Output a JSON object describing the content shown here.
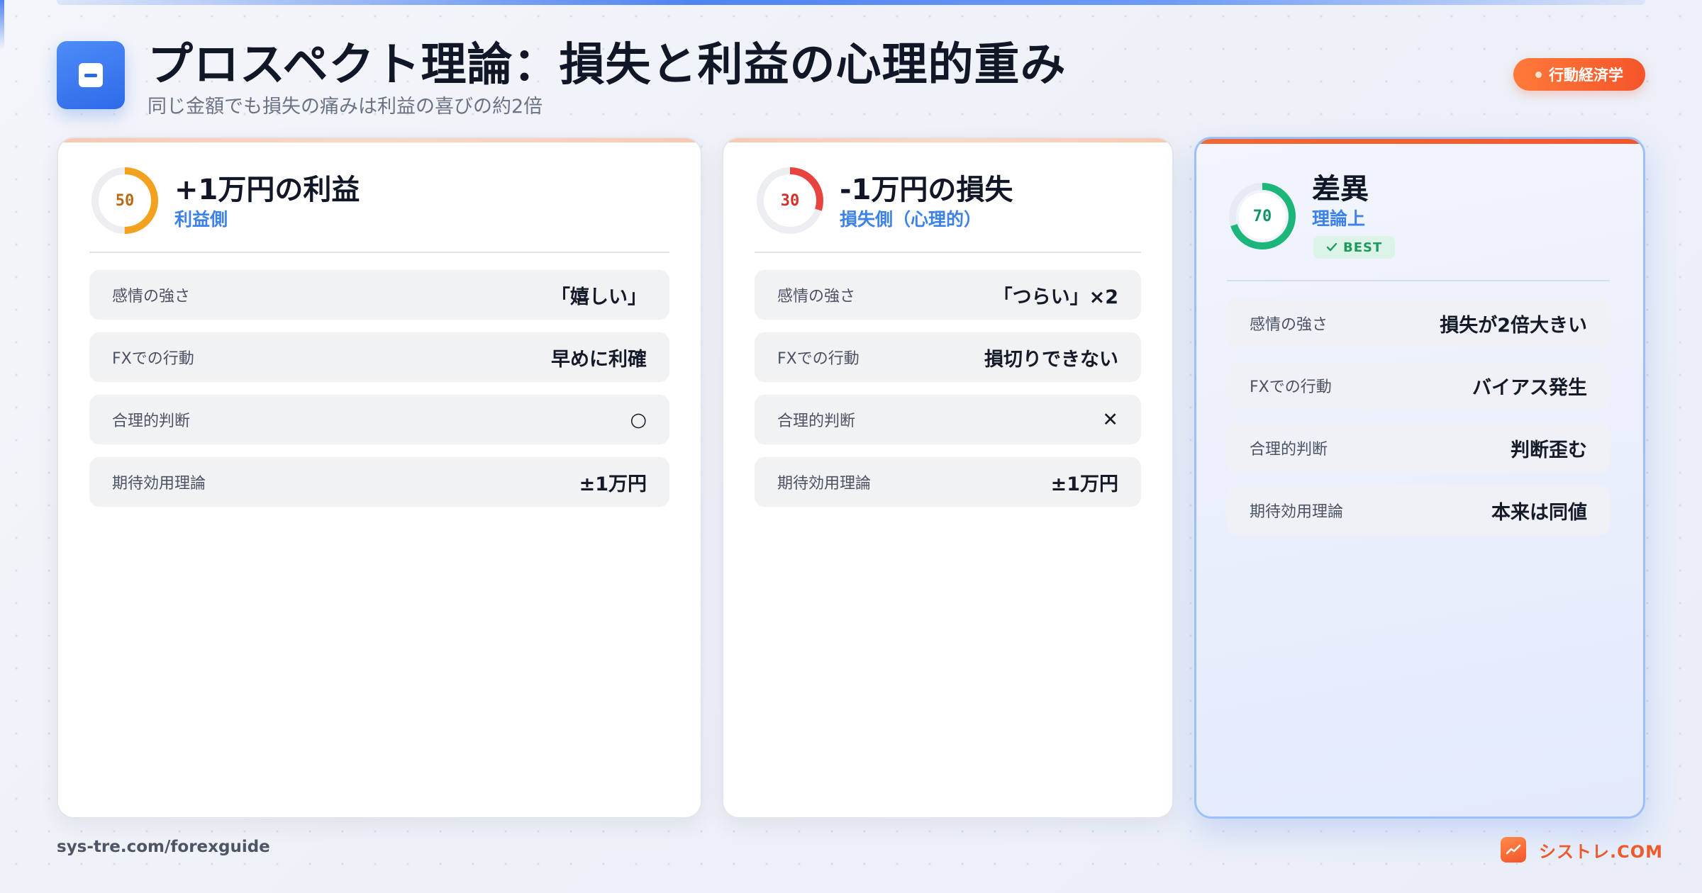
{
  "header": {
    "title": "プロスペクト理論：損失と利益の心理的重み",
    "subtitle": "同じ金額でも損失の痛みは利益の喜びの約2倍",
    "tag": "行動経済学"
  },
  "cards": [
    {
      "score": "50",
      "score_value": 50,
      "ring_color": "#f2a21e",
      "score_color": "#b86a12",
      "title": "+1万円の利益",
      "subtitle": "利益側",
      "rows": [
        {
          "label": "感情の強さ",
          "value": "「嬉しい」"
        },
        {
          "label": "FXでの行動",
          "value": "早めに利確"
        },
        {
          "label": "合理的判断",
          "value": "○"
        },
        {
          "label": "期待効用理論",
          "value": "±1万円"
        }
      ]
    },
    {
      "score": "30",
      "score_value": 30,
      "ring_color": "#e8443f",
      "score_color": "#d3302c",
      "title": "-1万円の損失",
      "subtitle": "損失側（心理的）",
      "rows": [
        {
          "label": "感情の強さ",
          "value": "「つらい」×2"
        },
        {
          "label": "FXでの行動",
          "value": "損切りできない"
        },
        {
          "label": "合理的判断",
          "value": "✕"
        },
        {
          "label": "期待効用理論",
          "value": "±1万円"
        }
      ]
    },
    {
      "score": "70",
      "score_value": 70,
      "ring_color": "#1cb57a",
      "score_color": "#139464",
      "title": "差異",
      "subtitle": "理論上",
      "badge": "BEST",
      "rows": [
        {
          "label": "感情の強さ",
          "value": "損失が2倍大きい"
        },
        {
          "label": "FXでの行動",
          "value": "バイアス発生"
        },
        {
          "label": "合理的判断",
          "value": "判断歪む"
        },
        {
          "label": "期待効用理論",
          "value": "本来は同値"
        }
      ]
    }
  ],
  "footer": {
    "url": "sys-tre.com/forexguide",
    "brand": "シストレ.COM"
  },
  "icons": {
    "logo": "minus-square-icon",
    "badge": "check-icon",
    "brand": "trending-up-icon"
  }
}
